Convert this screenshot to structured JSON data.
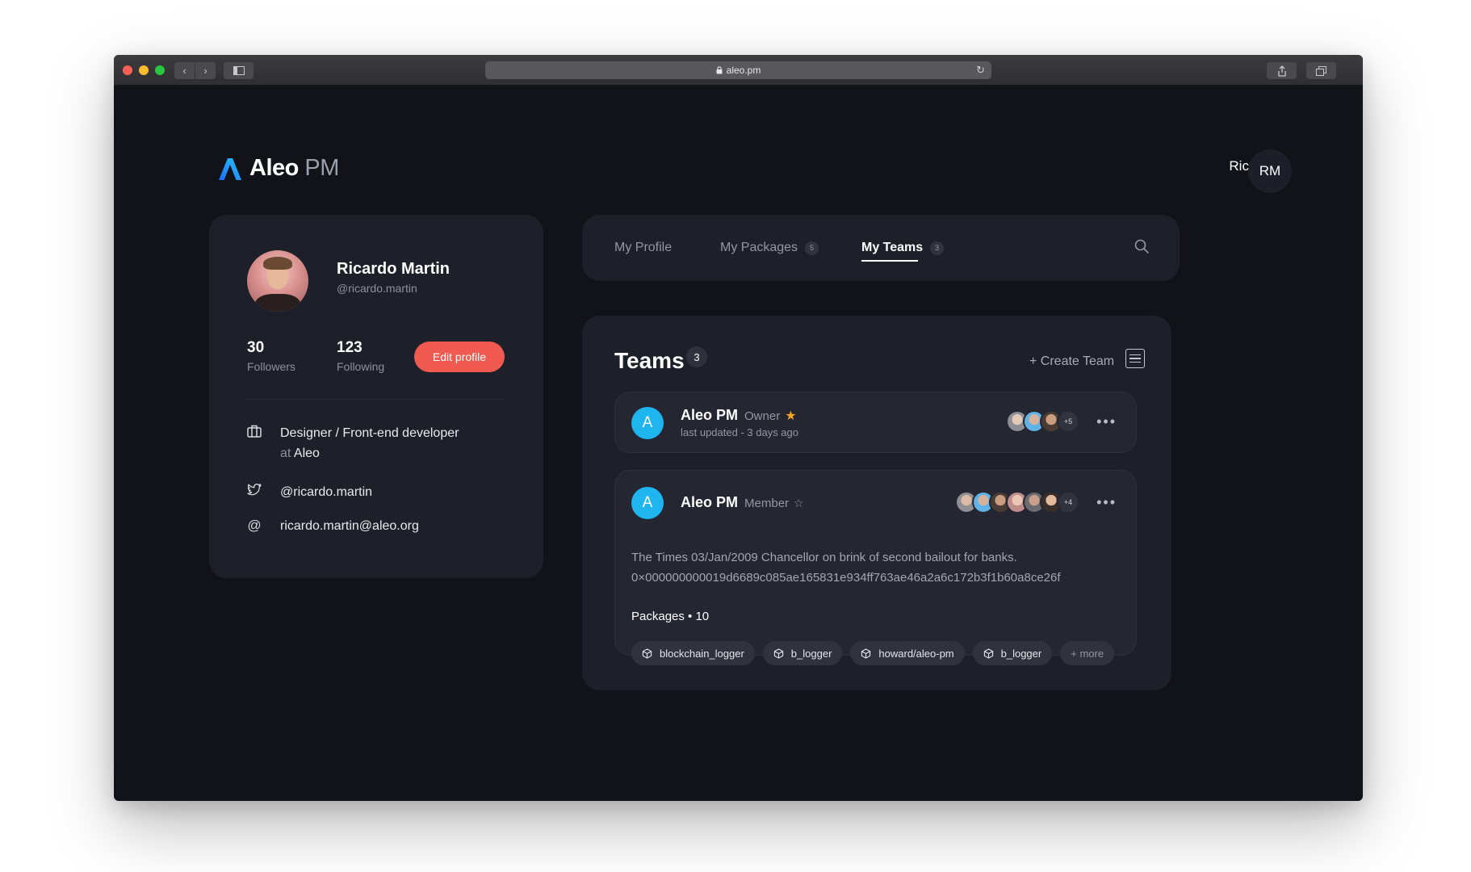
{
  "browser": {
    "url": "aleo.pm"
  },
  "brand": {
    "name": "Aleo",
    "suffix": "PM"
  },
  "header": {
    "user_name": "Ricardo",
    "user_initials": "RM"
  },
  "profile": {
    "name": "Ricardo Martin",
    "handle": "@ricardo.martin",
    "followers_count": "30",
    "followers_label": "Followers",
    "following_count": "123",
    "following_label": "Following",
    "edit_label": "Edit profile",
    "job_title": "Designer / Front-end developer",
    "job_at": "at",
    "company": "Aleo",
    "twitter": "@ricardo.martin",
    "email": "ricardo.martin@aleo.org"
  },
  "tabs": [
    {
      "label": "My Profile",
      "count": ""
    },
    {
      "label": "My Packages",
      "count": "5"
    },
    {
      "label": "My Teams",
      "count": "3"
    }
  ],
  "teams": {
    "title": "Teams",
    "count": "3",
    "create_label": "+ Create Team",
    "items": [
      {
        "initial": "A",
        "name": "Aleo PM",
        "role": "Owner",
        "updated": "last updated - 3 days ago",
        "members_more": "+5"
      },
      {
        "initial": "A",
        "name": "Aleo PM",
        "role": "Member",
        "description_line1": "The Times 03/Jan/2009 Chancellor on brink of second bailout for banks.",
        "description_line2": "0×000000000019d6689c085ae165831e934ff763ae46a2a6c172b3f1b60a8ce26f",
        "packages_label": "Packages • 10",
        "packages": [
          "blockchain_logger",
          "b_logger",
          "howard/aleo-pm",
          "b_logger"
        ],
        "packages_more": "+ more",
        "members_more": "+4"
      }
    ]
  },
  "colors": {
    "accent": "#f05a50",
    "team_avatar": "#1fb6f0",
    "star": "#f5a623",
    "background": "#111319",
    "card": "#1e2029"
  }
}
